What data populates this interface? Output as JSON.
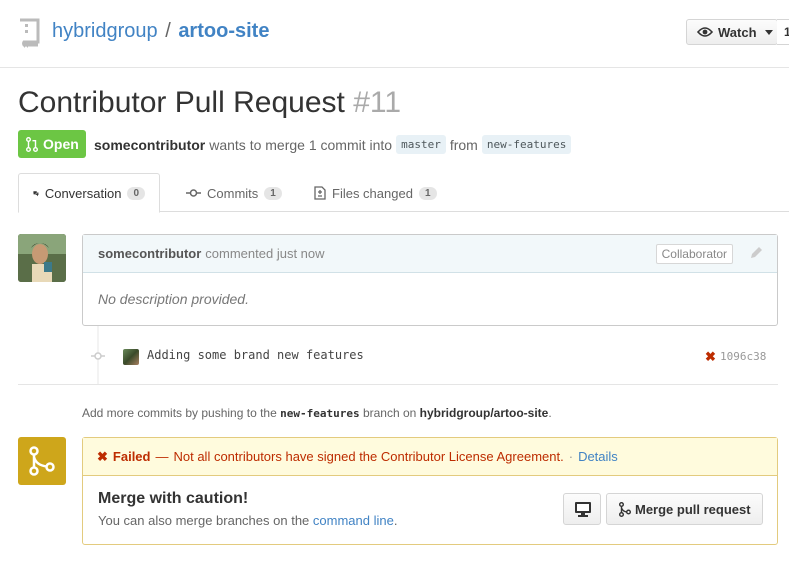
{
  "repo": {
    "owner": "hybridgroup",
    "separator": "/",
    "name": "artoo-site"
  },
  "watch": {
    "label": "Watch",
    "count": "1"
  },
  "pr": {
    "title": "Contributor Pull Request",
    "number": "#11",
    "state": "Open",
    "author": "somecontributor",
    "action_text": "wants to merge 1 commit into",
    "base_branch": "master",
    "from_text": "from",
    "head_branch": "new-features"
  },
  "tabs": [
    {
      "label": "Conversation",
      "count": "0"
    },
    {
      "label": "Commits",
      "count": "1"
    },
    {
      "label": "Files changed",
      "count": "1"
    }
  ],
  "comment": {
    "author": "somecontributor",
    "action": "commented just now",
    "role": "Collaborator",
    "body": "No description provided."
  },
  "commit": {
    "message": "Adding some brand new features",
    "sha": "1096c38",
    "status": "failed"
  },
  "help": {
    "prefix": "Add more commits by pushing to the",
    "branch": "new-features",
    "middle": "branch on",
    "repo": "hybridgroup/artoo-site",
    "suffix": "."
  },
  "merge": {
    "status_label": "Failed",
    "status_dash": "—",
    "status_message": "Not all contributors have signed the Contributor License Agreement.",
    "status_dot": "·",
    "details_link": "Details",
    "title": "Merge with caution!",
    "subtitle_prefix": "You can also merge branches on the",
    "subtitle_link": "command line",
    "subtitle_suffix": ".",
    "button_label": "Merge pull request"
  },
  "colors": {
    "open_green": "#6cc644",
    "link_blue": "#4183c4",
    "failed_red": "#bd2c00",
    "warning_yellow": "#cea61b"
  }
}
